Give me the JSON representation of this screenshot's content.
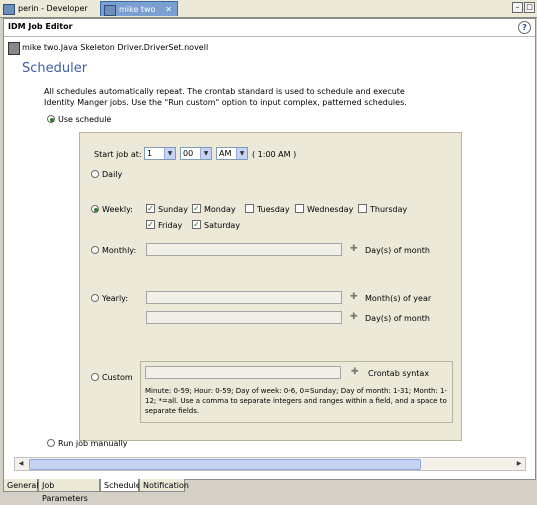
{
  "editor_tabs": [
    {
      "label": "perin - Developer",
      "icon": "project-icon"
    },
    {
      "label": "mike two",
      "icon": "project-icon",
      "close": "✕"
    }
  ],
  "window_controls": {
    "minimize": "–",
    "maximize": "□"
  },
  "header": {
    "title": "IDM Job Editor",
    "help": "?"
  },
  "job_path": "mike two.Java Skeleton Driver.DriverSet.novell",
  "section_title": "Scheduler",
  "description": "All schedules automatically repeat. The crontab standard is used to schedule and execute Identity Manger jobs. Use the \"Run custom\" option to input complex, patterned schedules.",
  "use_schedule_label": "Use schedule",
  "run_manually_label": "Run job manually",
  "start": {
    "label": "Start job at:",
    "hour": "1",
    "minute": "00",
    "ampm": "AM",
    "summary": "( 1:00 AM )"
  },
  "options": {
    "daily": "Daily",
    "weekly": "Weekly:",
    "monthly": "Monthly:",
    "yearly": "Yearly:",
    "custom": "Custom"
  },
  "weekdays": [
    {
      "label": "Sunday",
      "checked": true
    },
    {
      "label": "Monday",
      "checked": true
    },
    {
      "label": "Tuesday",
      "checked": false
    },
    {
      "label": "Wednesday",
      "checked": false
    },
    {
      "label": "Thursday",
      "checked": false
    },
    {
      "label": "Friday",
      "checked": true
    },
    {
      "label": "Saturday",
      "checked": true
    }
  ],
  "monthly_suffix": "Day(s) of month",
  "yearly_month_suffix": "Month(s) of year",
  "yearly_day_suffix": "Day(s) of month",
  "crontab_label": "Crontab syntax",
  "custom_help": "Minute: 0-59; Hour: 0-59; Day of week: 0-6, 0=Sunday; Day of month: 1-31; Month: 1-12; *=all. Use a comma to separate integers and ranges within a field, and a space to separate fields.",
  "bottom_tabs": [
    "General",
    "Job Parameters",
    "Schedule",
    "Notification"
  ],
  "active_bottom_tab": "Schedule",
  "colors": {
    "accent": "#3c5ea8",
    "selected_tab": "#7a9fd0",
    "check": "#1c6b1c"
  }
}
